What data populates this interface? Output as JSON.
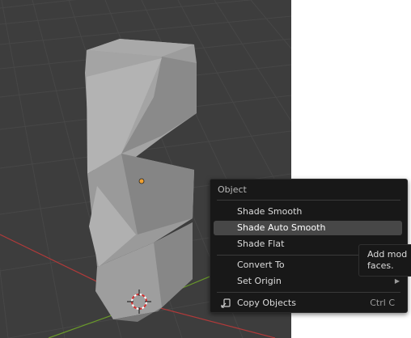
{
  "context_menu": {
    "title": "Object",
    "items": [
      {
        "label": "Shade Smooth",
        "shortcut": "",
        "submenu": false,
        "highlighted": false
      },
      {
        "label": "Shade Auto Smooth",
        "shortcut": "",
        "submenu": false,
        "highlighted": true
      },
      {
        "label": "Shade Flat",
        "shortcut": "",
        "submenu": false,
        "highlighted": false
      },
      {
        "label": "Convert To",
        "shortcut": "",
        "submenu": false,
        "highlighted": false
      },
      {
        "label": "Set Origin",
        "shortcut": "",
        "submenu": true,
        "highlighted": false
      },
      {
        "label": "Copy Objects",
        "shortcut": "Ctrl C",
        "submenu": false,
        "highlighted": false,
        "icon": "copy-icon"
      }
    ]
  },
  "tooltip": {
    "line1": "Add mod",
    "line2": "faces."
  },
  "colors": {
    "viewport_background": "#3d3d3d",
    "menu_background": "#181818",
    "highlight": "#474747",
    "object_gray": "#a8a8a8",
    "origin_dot": "#f0a030",
    "x_axis": "#b13a3a",
    "y_axis": "#6a9a2a"
  }
}
